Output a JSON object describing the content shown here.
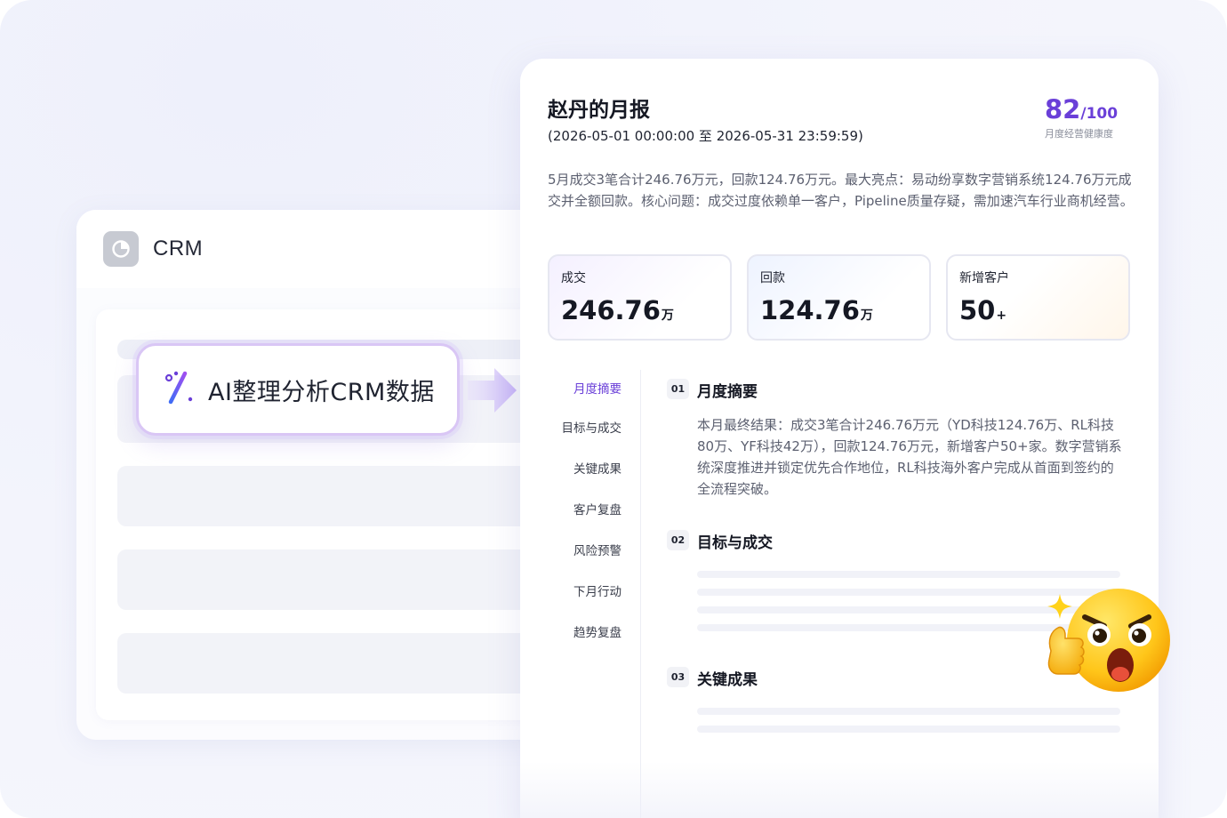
{
  "crm": {
    "title": "CRM",
    "logo_icon": "pie-chart-icon"
  },
  "ai_pill": {
    "label": "AI整理分析CRM数据",
    "icon": "magic-wand-icon"
  },
  "report": {
    "title": "赵丹的月报",
    "period": "(2026-05-01 00:00:00 至 2026-05-31 23:59:59)",
    "score": {
      "value": "82",
      "max": "/100",
      "label": "月度经营健康度"
    },
    "summary": "5月成交3笔合计246.76万元，回款124.76万元。最大亮点：易动纷享数字营销系统124.76万元成交并全额回款。核心问题：成交过度依赖单一客户，Pipeline质量存疑，需加速汽车行业商机经营。",
    "stats": [
      {
        "label": "成交",
        "value": "246.76",
        "unit": "万"
      },
      {
        "label": "回款",
        "value": "124.76",
        "unit": "万"
      },
      {
        "label": "新增客户",
        "value": "50",
        "unit": "+"
      }
    ],
    "nav": [
      {
        "label": "月度摘要",
        "active": true
      },
      {
        "label": "目标与成交",
        "active": false
      },
      {
        "label": "关键成果",
        "active": false
      },
      {
        "label": "客户复盘",
        "active": false
      },
      {
        "label": "风险预警",
        "active": false
      },
      {
        "label": "下月行动",
        "active": false
      },
      {
        "label": "趋势复盘",
        "active": false
      }
    ],
    "sections": [
      {
        "num": "01",
        "title": "月度摘要",
        "body": "本月最终结果：成交3笔合计246.76万元（YD科技124.76万、RL科技80万、YF科技42万），回款124.76万元，新增客户50+家。数字营销系统深度推进并锁定优先合作地位，RL科技海外客户完成从首面到签约的全流程突破。"
      },
      {
        "num": "02",
        "title": "目标与成交"
      },
      {
        "num": "03",
        "title": "关键成果"
      }
    ]
  },
  "colors": {
    "accent": "#6a3fd8",
    "pill_border": "#d9c6f5",
    "arrow": "#c9b8f6"
  },
  "decor": {
    "emoji": "surprised-thumbs-up-emoji-icon",
    "sparkle": "sparkle-icon"
  }
}
